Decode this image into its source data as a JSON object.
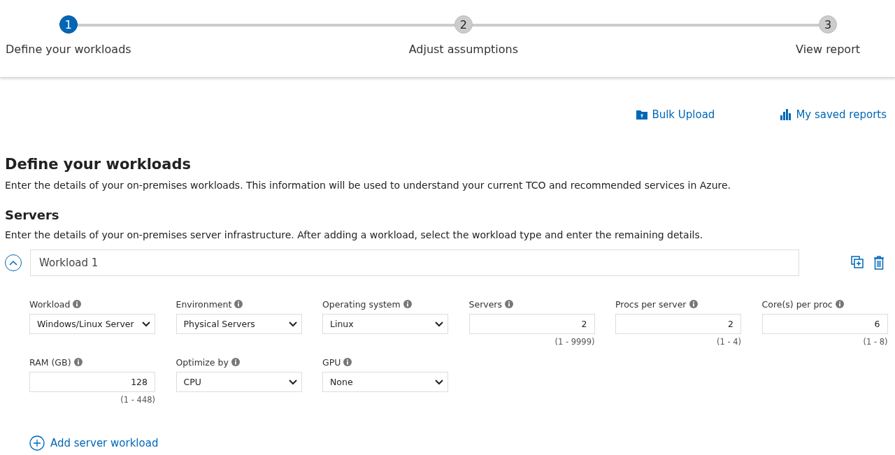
{
  "steps": [
    {
      "number": "1",
      "label": "Define your workloads",
      "selected": true
    },
    {
      "number": "2",
      "label": "Adjust assumptions",
      "selected": false
    },
    {
      "number": "3",
      "label": "View report",
      "selected": false
    }
  ],
  "actions": [
    {
      "kind": "upload",
      "label": "Bulk Upload"
    },
    {
      "kind": "reports",
      "label": "My saved reports"
    }
  ],
  "page_title": "Define your workloads",
  "page_description": "Enter the details of your on-premises workloads. This information will be used to understand your current TCO and recommended services in Azure.",
  "section_title": "Servers",
  "section_description": "Enter the details of your on-premises server infrastructure. After adding a workload, select the workload type and enter the remaining details.",
  "workload": {
    "name": "Workload 1",
    "expanded": true,
    "fields": [
      {
        "kind": "select",
        "label": "Workload",
        "value": "Windows/Linux Server"
      },
      {
        "kind": "select",
        "label": "Environment",
        "value": "Physical Servers"
      },
      {
        "kind": "select",
        "label": "Operating system",
        "value": "Linux"
      },
      {
        "kind": "number",
        "label": "Servers",
        "value": "2",
        "range": "(1 - 9999)"
      },
      {
        "kind": "number",
        "label": "Procs per server",
        "value": "2",
        "range": "(1 - 4)"
      },
      {
        "kind": "number",
        "label": "Core(s) per proc",
        "value": "6",
        "range": "(1 - 8)"
      },
      {
        "kind": "number",
        "label": "RAM (GB)",
        "value": "128",
        "range": "(1 - 448)"
      },
      {
        "kind": "select",
        "label": "Optimize by",
        "value": "CPU"
      },
      {
        "kind": "select",
        "label": "GPU",
        "value": "None"
      }
    ]
  },
  "add_button": "Add server workload"
}
